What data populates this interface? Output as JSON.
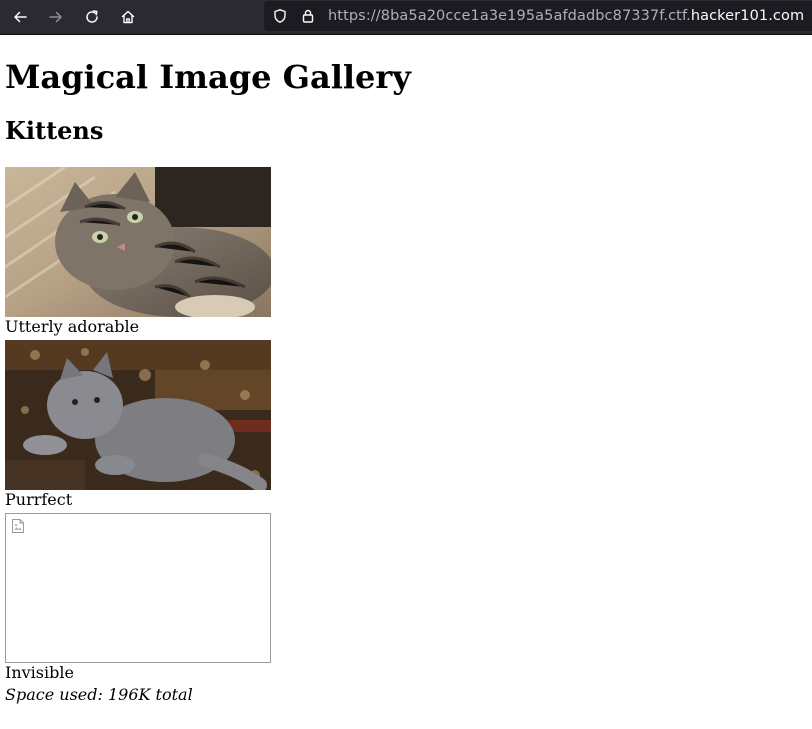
{
  "browser": {
    "url_prefix": "https://8ba5a20cce1a3e195a5afdadbc87337f.ctf.",
    "url_domain": "hacker101.com",
    "icons": [
      "back-arrow-icon",
      "forward-arrow-icon",
      "reload-icon",
      "home-icon",
      "shield-icon",
      "lock-icon"
    ]
  },
  "page": {
    "title": "Magical Image Gallery",
    "section_title": "Kittens",
    "images": [
      {
        "caption": "Utterly adorable",
        "status": "loaded"
      },
      {
        "caption": "Purrfect",
        "status": "loaded"
      },
      {
        "caption": "Invisible",
        "status": "broken"
      }
    ],
    "space_used": "Space used: 196K total"
  },
  "colors": {
    "toolbar_bg": "#2b2a33",
    "urlbar_bg": "#1c1b22",
    "url_prefix": "#b0afb7",
    "url_domain": "#fbfbfe"
  }
}
